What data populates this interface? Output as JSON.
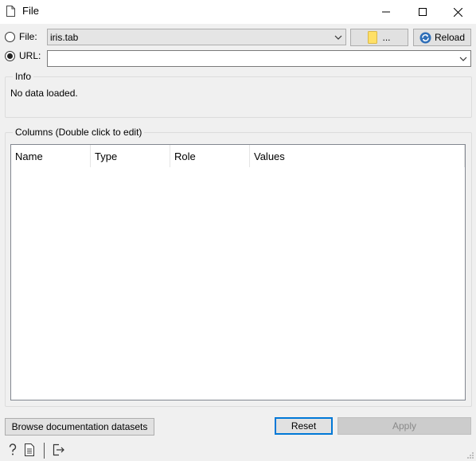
{
  "window": {
    "title": "File",
    "controls": [
      "minimize",
      "maximize",
      "close"
    ]
  },
  "source": {
    "file_label": "File:",
    "file_selected": false,
    "file_value": "iris.tab",
    "browse_button_label": "...",
    "reload_button_label": "Reload",
    "url_label": "URL:",
    "url_selected": true,
    "url_value": ""
  },
  "info": {
    "title": "Info",
    "text": "No data loaded."
  },
  "columns": {
    "title": "Columns (Double click to edit)",
    "headers": [
      "Name",
      "Type",
      "Role",
      "Values"
    ],
    "rows": []
  },
  "footer": {
    "browse_docs_label": "Browse documentation datasets",
    "reset_label": "Reset",
    "apply_label": "Apply",
    "apply_enabled": false
  },
  "statusbar": {
    "icons": [
      "help-icon",
      "report-icon",
      "output-icon"
    ]
  }
}
